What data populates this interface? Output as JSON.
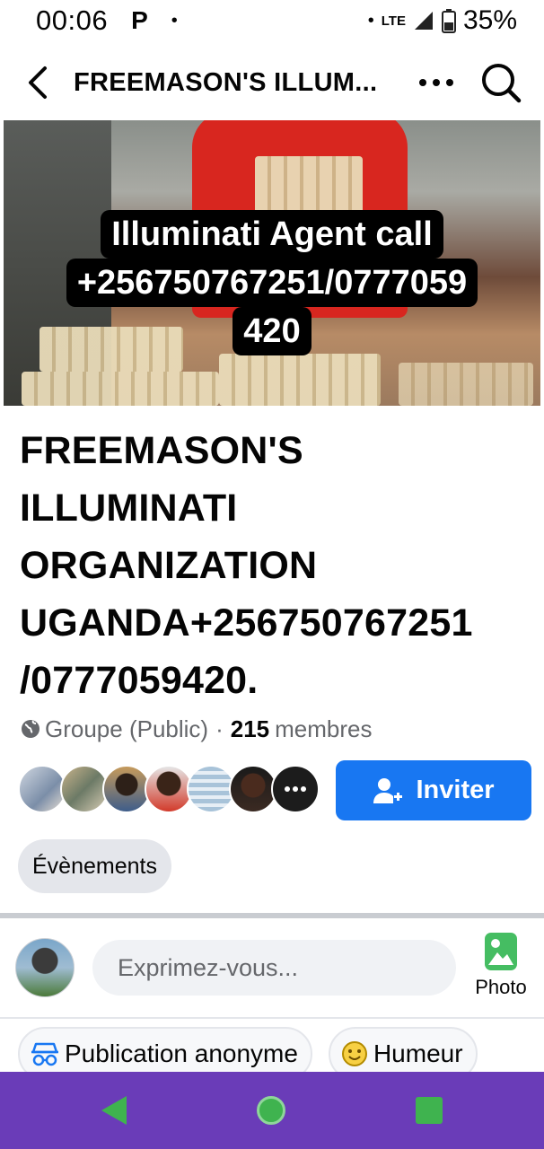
{
  "status": {
    "time": "00:06",
    "notif_icon": "P",
    "dot": "•",
    "network": "LTE",
    "battery": "35%"
  },
  "topbar": {
    "title": "FREEMASON'S ILLUM..."
  },
  "cover": {
    "caption_line1": "Illuminati Agent call",
    "caption_line2": "+256750767251/0777059",
    "caption_line3": "420"
  },
  "group": {
    "title_lines": [
      "FREEMASON'S",
      "ILLUMINATI",
      "ORGANIZATION",
      "UGANDA+256750767251",
      "/0777059420."
    ],
    "type": "Groupe (Public)",
    "separator": "·",
    "member_count": "215",
    "members_label": "membres"
  },
  "actions": {
    "invite_label": "Inviter",
    "events_label": "Évènements"
  },
  "composer": {
    "placeholder": "Exprimez-vous...",
    "photo_label": "Photo"
  },
  "chips": {
    "anonymous_label": "Publication anonyme",
    "mood_label": "Humeur"
  },
  "colors": {
    "accent": "#1877f2",
    "navbar": "#6a3cb8",
    "nav_icons": "#3fb34f"
  }
}
